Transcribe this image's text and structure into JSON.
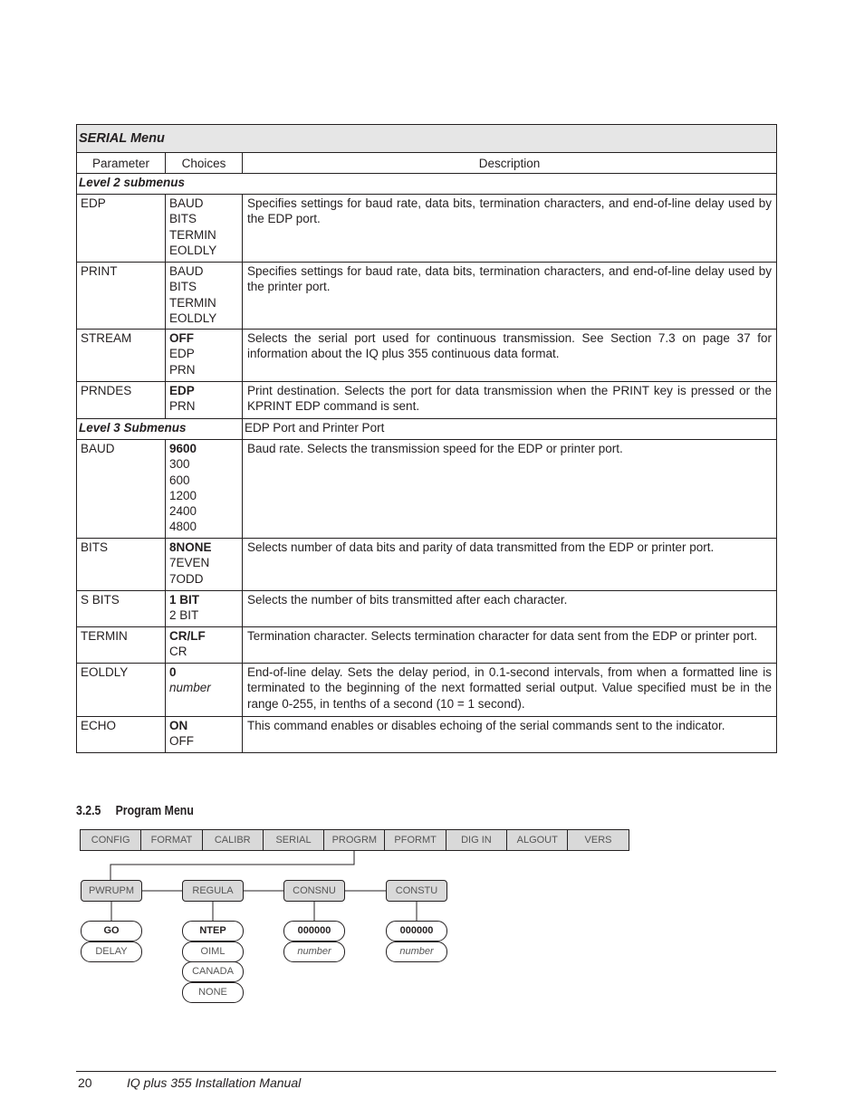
{
  "table": {
    "title": "SERIAL Menu",
    "headers": [
      "Parameter",
      "Choices",
      "Description"
    ],
    "sections": [
      {
        "label": "Level 2 submenus",
        "note": "",
        "rows": [
          {
            "param": "EDP",
            "choices": [
              "BAUD",
              "BITS",
              "TERMIN",
              "EOLDLY"
            ],
            "default_bold": false,
            "description": "Specifies settings for baud rate, data bits, termination characters, and end-of-line delay used by the EDP port."
          },
          {
            "param": "PRINT",
            "choices": [
              "BAUD",
              "BITS",
              "TERMIN",
              "EOLDLY"
            ],
            "default_bold": false,
            "description": "Specifies settings for baud rate, data bits, termination characters, and end-of-line delay used by the printer port."
          },
          {
            "param": "STREAM",
            "choices": [
              "OFF",
              "EDP",
              "PRN"
            ],
            "default_bold": true,
            "description": "Selects the serial port used for continuous transmission. See Section 7.3 on page 37 for information about the IQ plus 355 continuous data format."
          },
          {
            "param": "PRNDES",
            "choices": [
              "EDP",
              "PRN"
            ],
            "default_bold": true,
            "description": "Print destination. Selects the port for data transmission when the PRINT key is pressed or the KPRINT EDP command is sent."
          }
        ]
      },
      {
        "label": "Level 3 Submenus",
        "note": "EDP Port and Printer Port",
        "rows": [
          {
            "param": "BAUD",
            "choices": [
              "9600",
              "300",
              "600",
              "1200",
              "2400",
              "4800"
            ],
            "default_bold": true,
            "description": "Baud rate. Selects the transmission speed for the EDP or printer port."
          },
          {
            "param": "BITS",
            "choices": [
              "8NONE",
              "7EVEN",
              "7ODD"
            ],
            "default_bold": true,
            "description": "Selects number of data bits and parity of data transmitted from the EDP or printer port."
          },
          {
            "param": "S BITS",
            "choices": [
              "1 BIT",
              "2 BIT"
            ],
            "default_bold": true,
            "description": "Selects the number of bits transmitted after each character."
          },
          {
            "param": "TERMIN",
            "choices": [
              "CR/LF",
              "CR"
            ],
            "default_bold": true,
            "description": "Termination character. Selects termination character for data sent from the EDP or printer port."
          },
          {
            "param": "EOLDLY",
            "choices": [
              "0",
              "number"
            ],
            "default_bold": true,
            "description": "End-of-line delay. Sets the delay period, in 0.1-second intervals, from when a formatted line is terminated to the beginning of the next formatted serial output. Value specified must be in the range 0-255, in tenths of a second (10 = 1 second)."
          },
          {
            "param": "ECHO",
            "choices": [
              "ON",
              "OFF"
            ],
            "default_bold": true,
            "description": "This command enables or disables echoing of the serial commands sent to the indicator."
          }
        ]
      }
    ]
  },
  "section": {
    "number": "3.2.5",
    "title": "Program Menu"
  },
  "diagram": {
    "menu": [
      "CONFIG",
      "FORMAT",
      "CALIBR",
      "SERIAL",
      "PROGRM",
      "PFORMT",
      "DIG IN",
      "ALGOUT",
      "VERS"
    ],
    "selected": "PROGRM",
    "params": [
      {
        "name": "PWRUPM",
        "choices": [
          "GO",
          "DELAY"
        ]
      },
      {
        "name": "REGULA",
        "choices": [
          "NTEP",
          "OIML",
          "CANADA",
          "NONE"
        ]
      },
      {
        "name": "CONSNU",
        "choices": [
          "000000",
          "number"
        ]
      },
      {
        "name": "CONSTU",
        "choices": [
          "000000",
          "number"
        ]
      }
    ]
  },
  "footer": {
    "page": "20",
    "title": "IQ plus 355 Installation Manual"
  }
}
